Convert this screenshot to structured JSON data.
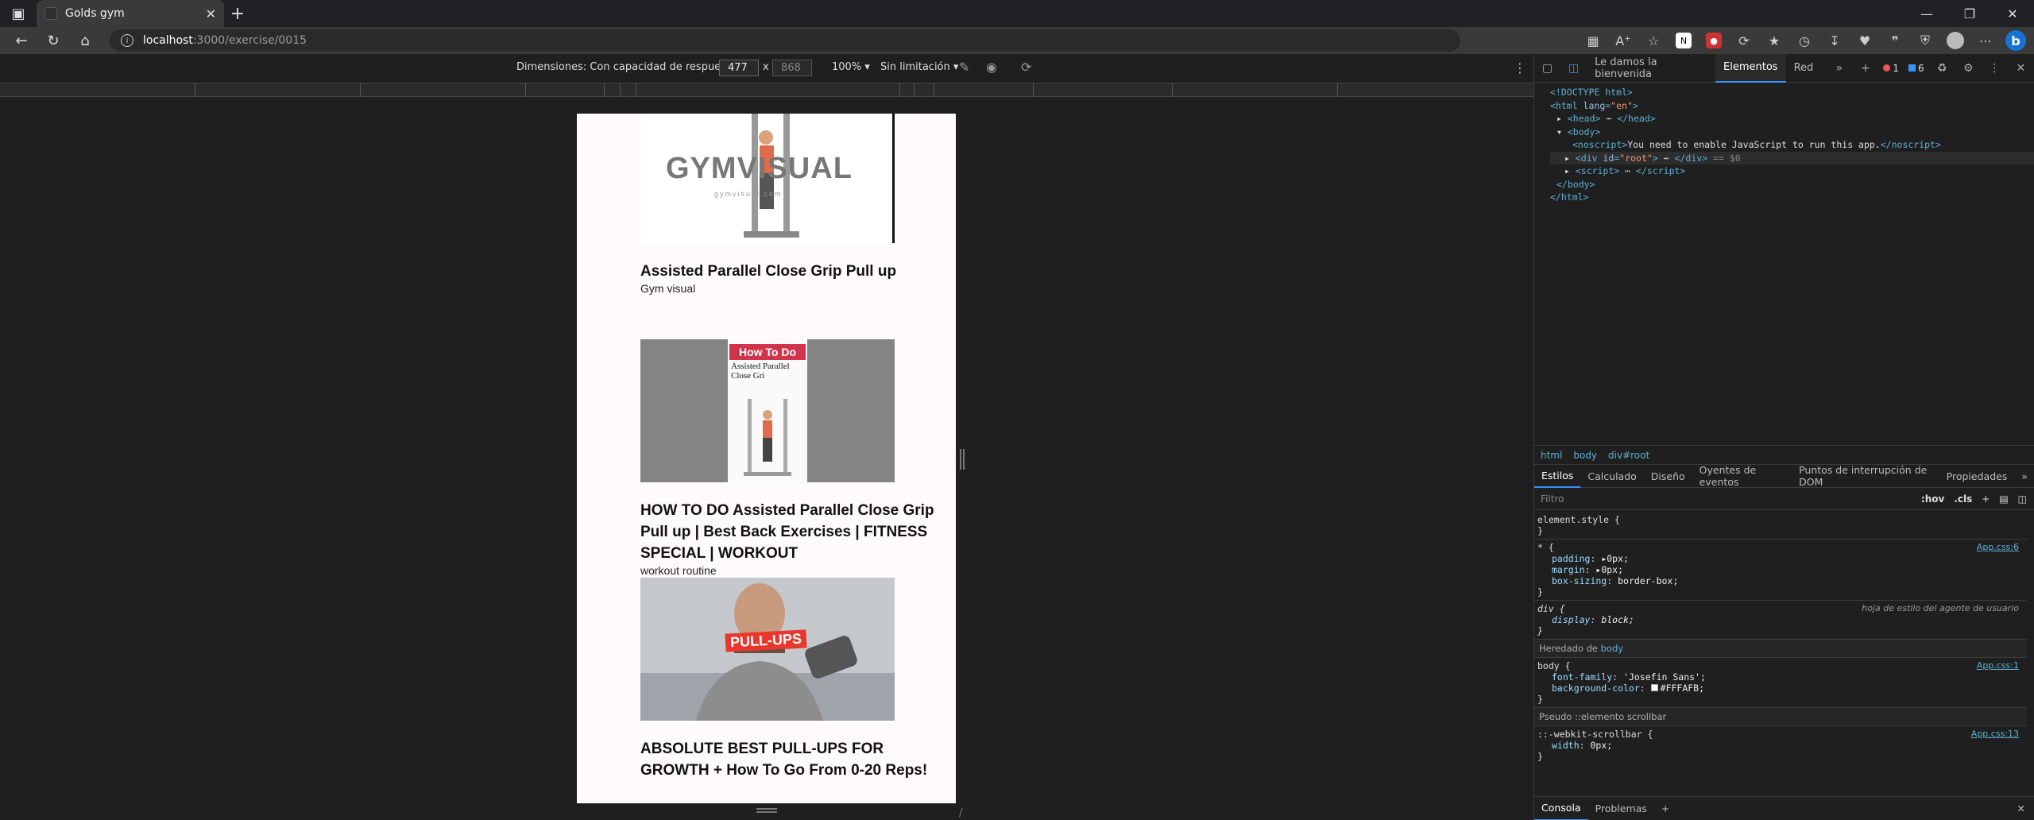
{
  "browser": {
    "tab_title": "Golds gym",
    "url_host": "localhost",
    "url_path": ":3000/exercise/0015"
  },
  "device_toolbar": {
    "dimensions_label": "Dimensiones: Con capacidad de respuesta",
    "width": "477",
    "x": "x",
    "height": "868",
    "zoom": "100%",
    "throttling": "Sin limitación"
  },
  "page": {
    "videos": [
      {
        "title": "Assisted Parallel Close Grip Pull up",
        "channel": "Gym visual",
        "thumb_text": "GYMVISUAL",
        "thumb_sub": "gymvisual.com"
      },
      {
        "title": "HOW TO DO Assisted Parallel Close Grip Pull up | Best Back Exercises | FITNESS SPECIAL | WORKOUT",
        "channel": "workout routine",
        "thumb_text": "How To Do",
        "thumb_sub": "Assisted Parallel Close Gri"
      },
      {
        "title": "ABSOLUTE BEST PULL-UPS FOR GROWTH + How To Go From 0-20 Reps!",
        "channel": "",
        "thumb_text": "PULL-UPS",
        "thumb_sub": ""
      }
    ]
  },
  "devtools": {
    "tabs": [
      "Le damos la bienvenida",
      "Elementos",
      "Red"
    ],
    "error_count": "1",
    "info_count": "6",
    "dom": {
      "doctype": "<!DOCTYPE html>",
      "noscript_text": "You need to enable JavaScript to run this app.",
      "root_marker": "== $0"
    },
    "breadcrumbs": [
      "html",
      "body",
      "div#root"
    ],
    "subtabs": [
      "Estilos",
      "Calculado",
      "Diseño",
      "Oyentes de eventos",
      "Puntos de interrupción de DOM",
      "Propiedades"
    ],
    "filter_placeholder": "Filtro",
    "hov": ":hov",
    "cls": ".cls",
    "styles": {
      "element_style": "element.style {",
      "star_src": "App.css:6",
      "ua_label": "hoja de estilo del agente de usuario",
      "inherited_label": "Heredado de",
      "inherited_from": "body",
      "body_src": "App.css:1",
      "font_family": "'Josefin Sans';",
      "bg_color": "#FFFAFB;",
      "pseudo_label": "Pseudo ::elemento scrollbar",
      "scroll_src": "App.css:13"
    },
    "drawer": [
      "Consola",
      "Problemas"
    ]
  }
}
